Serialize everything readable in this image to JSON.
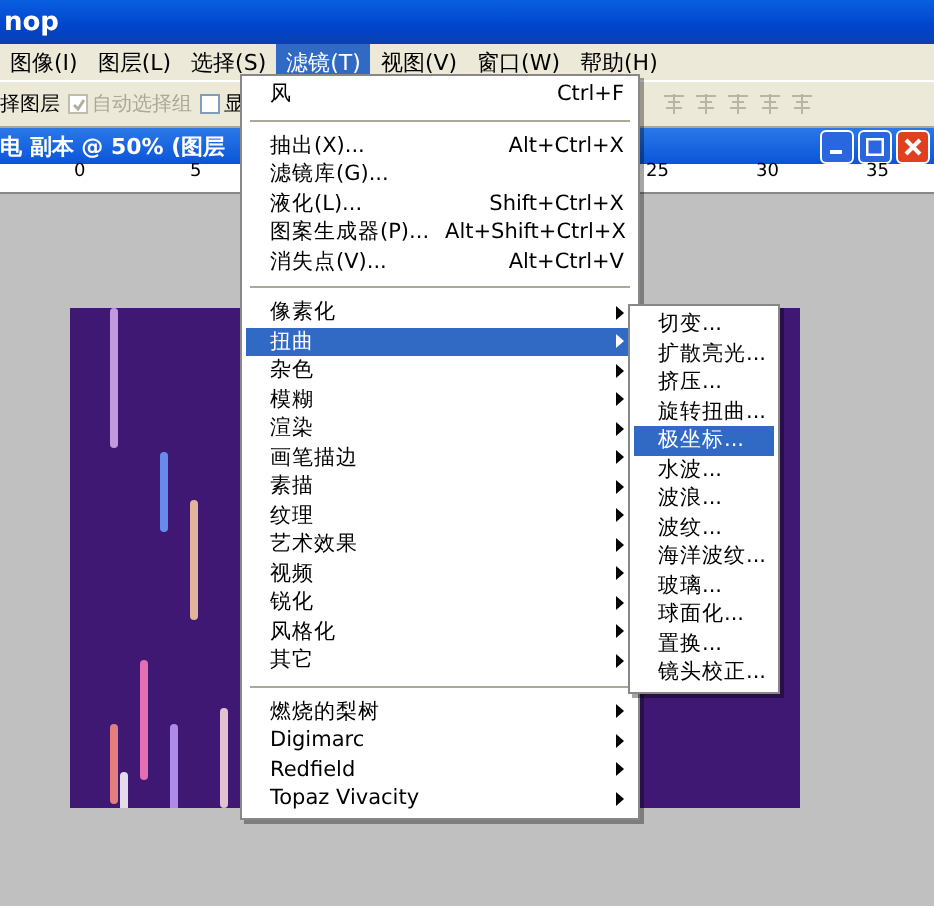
{
  "window": {
    "title": "nop"
  },
  "menu_bar": [
    {
      "label": "图像(I)",
      "selected": false
    },
    {
      "label": "图层(L)",
      "selected": false
    },
    {
      "label": "选择(S)",
      "selected": false
    },
    {
      "label": "滤镜(T)",
      "selected": true
    },
    {
      "label": "视图(V)",
      "selected": false
    },
    {
      "label": "窗口(W)",
      "selected": false
    },
    {
      "label": "帮助(H)",
      "selected": false
    }
  ],
  "options_bar": {
    "layer_label": "择图层",
    "auto_select_group": {
      "label": "自动选择组",
      "checked": true,
      "disabled": true
    },
    "show_checkbox": {
      "label": "显",
      "checked": false,
      "disabled": false
    }
  },
  "document": {
    "title": "电 副本 @ 50% (图层",
    "ruler_labels": [
      "0",
      "5",
      "25",
      "30",
      "35"
    ]
  },
  "filter_menu": [
    {
      "kind": "item",
      "label": "风",
      "shortcut": "Ctrl+F",
      "selected": false
    },
    {
      "kind": "separator"
    },
    {
      "kind": "item",
      "label": "抽出(X)...",
      "shortcut": "Alt+Ctrl+X",
      "selected": false
    },
    {
      "kind": "item",
      "label": "滤镜库(G)...",
      "selected": false
    },
    {
      "kind": "item",
      "label": "液化(L)...",
      "shortcut": "Shift+Ctrl+X",
      "selected": false
    },
    {
      "kind": "item",
      "label": "图案生成器(P)...",
      "shortcut": "Alt+Shift+Ctrl+X",
      "selected": false
    },
    {
      "kind": "item",
      "label": "消失点(V)...",
      "shortcut": "Alt+Ctrl+V",
      "selected": false
    },
    {
      "kind": "separator"
    },
    {
      "kind": "submenu",
      "label": "像素化",
      "selected": false
    },
    {
      "kind": "submenu",
      "label": "扭曲",
      "selected": true
    },
    {
      "kind": "submenu",
      "label": "杂色",
      "selected": false
    },
    {
      "kind": "submenu",
      "label": "模糊",
      "selected": false
    },
    {
      "kind": "submenu",
      "label": "渲染",
      "selected": false
    },
    {
      "kind": "submenu",
      "label": "画笔描边",
      "selected": false
    },
    {
      "kind": "submenu",
      "label": "素描",
      "selected": false
    },
    {
      "kind": "submenu",
      "label": "纹理",
      "selected": false
    },
    {
      "kind": "submenu",
      "label": "艺术效果",
      "selected": false
    },
    {
      "kind": "submenu",
      "label": "视频",
      "selected": false
    },
    {
      "kind": "submenu",
      "label": "锐化",
      "selected": false
    },
    {
      "kind": "submenu",
      "label": "风格化",
      "selected": false
    },
    {
      "kind": "submenu",
      "label": "其它",
      "selected": false
    },
    {
      "kind": "separator"
    },
    {
      "kind": "submenu",
      "label": "燃烧的梨树",
      "selected": false
    },
    {
      "kind": "submenu",
      "label": "Digimarc",
      "selected": false
    },
    {
      "kind": "submenu",
      "label": "Redfield",
      "selected": false
    },
    {
      "kind": "submenu",
      "label": "Topaz Vivacity",
      "selected": false
    }
  ],
  "distort_submenu": [
    {
      "label": "切变...",
      "selected": false
    },
    {
      "label": "扩散亮光...",
      "selected": false
    },
    {
      "label": "挤压...",
      "selected": false
    },
    {
      "label": "旋转扭曲...",
      "selected": false
    },
    {
      "label": "极坐标...",
      "selected": true
    },
    {
      "label": "水波...",
      "selected": false
    },
    {
      "label": "波浪...",
      "selected": false
    },
    {
      "label": "波纹...",
      "selected": false
    },
    {
      "label": "海洋波纹...",
      "selected": false
    },
    {
      "label": "玻璃...",
      "selected": false
    },
    {
      "label": "球面化...",
      "selected": false
    },
    {
      "label": "置换...",
      "selected": false
    },
    {
      "label": "镜头校正...",
      "selected": false
    }
  ]
}
